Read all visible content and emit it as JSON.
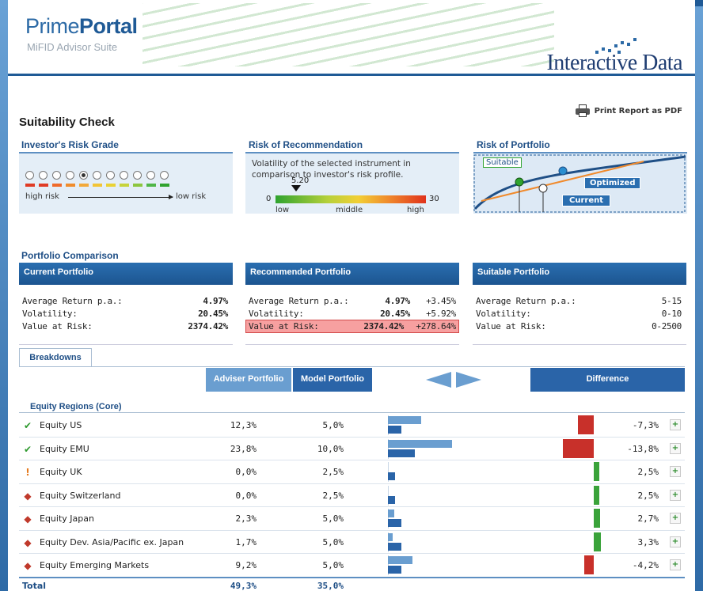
{
  "header": {
    "brand_light": "Prime",
    "brand_bold": "Portal",
    "subtitle": "MiFID Advisor Suite",
    "vendor": "Interactive Data"
  },
  "page": {
    "title": "Suitability Check",
    "print_label": "Print Report as PDF"
  },
  "risk_grade": {
    "title": "Investor's Risk Grade",
    "high_label": "high risk",
    "low_label": "low risk",
    "selected_index": 4,
    "count": 11,
    "bar_colors": [
      "#e03b25",
      "#e03b25",
      "#ef6a2a",
      "#f08c2c",
      "#f2a93a",
      "#f2c436",
      "#e9d234",
      "#c6d33a",
      "#8cc63f",
      "#4fb648",
      "#2fa32f"
    ]
  },
  "recommendation": {
    "title": "Risk of Recommendation",
    "text": "Volatility of the selected instrument in comparison to investor's risk profile.",
    "value": "5.20",
    "min": "0",
    "max": "30",
    "low": "low",
    "middle": "middle",
    "high": "high"
  },
  "portfolio_risk": {
    "title": "Risk of Portfolio",
    "suitable": "Suitable",
    "optimized": "Optimized",
    "current": "Current"
  },
  "comparison": {
    "title": "Portfolio Comparison",
    "labels": {
      "avg_return": "Average Return p.a.:",
      "volatility": "Volatility:",
      "var": "Value at Risk:"
    },
    "current": {
      "title": "Current Portfolio",
      "avg_return": "4.97%",
      "volatility": "20.45%",
      "var": "2374.42%"
    },
    "recommended": {
      "title": "Recommended Portfolio",
      "avg_return": "4.97%",
      "avg_return_delta": "+3.45%",
      "volatility": "20.45%",
      "volatility_delta": "+5.92%",
      "var": "2374.42%",
      "var_delta": "+278.64%"
    },
    "suitable": {
      "title": "Suitable Portfolio",
      "avg_return": "5-15",
      "volatility": "0-10",
      "var": "0-2500"
    }
  },
  "breakdowns": {
    "tab": "Breakdowns",
    "col_adviser": "Adviser Portfolio",
    "col_model": "Model Portfolio",
    "col_difference": "Difference",
    "group": "Equity Regions (Core)",
    "rows": [
      {
        "icon": "check",
        "name": "Equity US",
        "adviser": "12,3%",
        "model": "5,0%",
        "adviser_num": 12.3,
        "model_num": 5.0,
        "diff": "-7,3%",
        "diff_num": -7.3
      },
      {
        "icon": "check",
        "name": "Equity EMU",
        "adviser": "23,8%",
        "model": "10,0%",
        "adviser_num": 23.8,
        "model_num": 10.0,
        "diff": "-13,8%",
        "diff_num": -13.8
      },
      {
        "icon": "warn",
        "name": "Equity UK",
        "adviser": "0,0%",
        "model": "2,5%",
        "adviser_num": 0.0,
        "model_num": 2.5,
        "diff": "2,5%",
        "diff_num": 2.5
      },
      {
        "icon": "diamond",
        "name": "Equity Switzerland",
        "adviser": "0,0%",
        "model": "2,5%",
        "adviser_num": 0.0,
        "model_num": 2.5,
        "diff": "2,5%",
        "diff_num": 2.5
      },
      {
        "icon": "diamond",
        "name": "Equity Japan",
        "adviser": "2,3%",
        "model": "5,0%",
        "adviser_num": 2.3,
        "model_num": 5.0,
        "diff": "2,7%",
        "diff_num": 2.7
      },
      {
        "icon": "diamond",
        "name": "Equity Dev. Asia/Pacific ex. Japan",
        "adviser": "1,7%",
        "model": "5,0%",
        "adviser_num": 1.7,
        "model_num": 5.0,
        "diff": "3,3%",
        "diff_num": 3.3
      },
      {
        "icon": "diamond",
        "name": "Equity Emerging Markets",
        "adviser": "9,2%",
        "model": "5,0%",
        "adviser_num": 9.2,
        "model_num": 5.0,
        "diff": "-4,2%",
        "diff_num": -4.2
      }
    ],
    "total": {
      "label": "Total",
      "adviser": "49,3%",
      "model": "35,0%"
    }
  },
  "colors": {
    "brand": "#1f5a96",
    "positive": "#3aa33a",
    "negative": "#c8302a"
  }
}
